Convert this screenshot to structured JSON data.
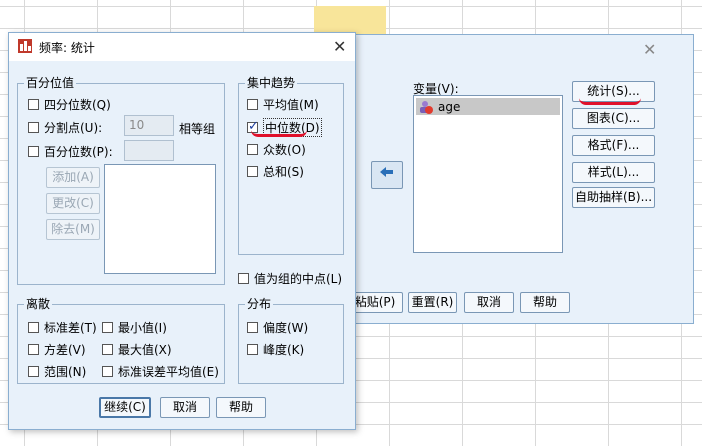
{
  "background": {
    "grid_color": "#d9d9d9",
    "highlight_color": "#f8e59a"
  },
  "main_dialog": {
    "variables_label": "变量(V):",
    "variables": [
      {
        "name": "age",
        "icon": "scale-variable-icon"
      }
    ],
    "arrow_icon": "move-left-arrow-icon",
    "side_buttons": [
      "统计(S)...",
      "图表(C)...",
      "格式(F)...",
      "样式(L)...",
      "自助抽样(B)..."
    ],
    "bottom_buttons": [
      "粘贴(P)",
      "重置(R)",
      "取消",
      "帮助"
    ]
  },
  "stats_dialog": {
    "title": "频率: 统计",
    "percentile_group": {
      "title": "百分位值",
      "quartiles": "四分位数(Q)",
      "cut_points": "分割点(U):",
      "cut_points_value": "10",
      "cut_points_suffix": "相等组",
      "percentiles": "百分位数(P):",
      "add": "添加(A)",
      "change": "更改(C)",
      "remove": "除去(M)"
    },
    "central_group": {
      "title": "集中趋势",
      "mean": "平均值(M)",
      "median": "中位数(D)",
      "median_checked": true,
      "mode": "众数(O)",
      "sum": "总和(S)"
    },
    "midpoints": "值为组的中点(L)",
    "dispersion_group": {
      "title": "离散",
      "std_dev": "标准差(T)",
      "minimum": "最小值(I)",
      "variance": "方差(V)",
      "maximum": "最大值(X)",
      "range": "范围(N)",
      "se_mean": "标准误差平均值(E)"
    },
    "distribution_group": {
      "title": "分布",
      "skewness": "偏度(W)",
      "kurtosis": "峰度(K)"
    },
    "continue": "继续(C)",
    "cancel": "取消",
    "help": "帮助"
  },
  "annotation_color": "#e0102a"
}
